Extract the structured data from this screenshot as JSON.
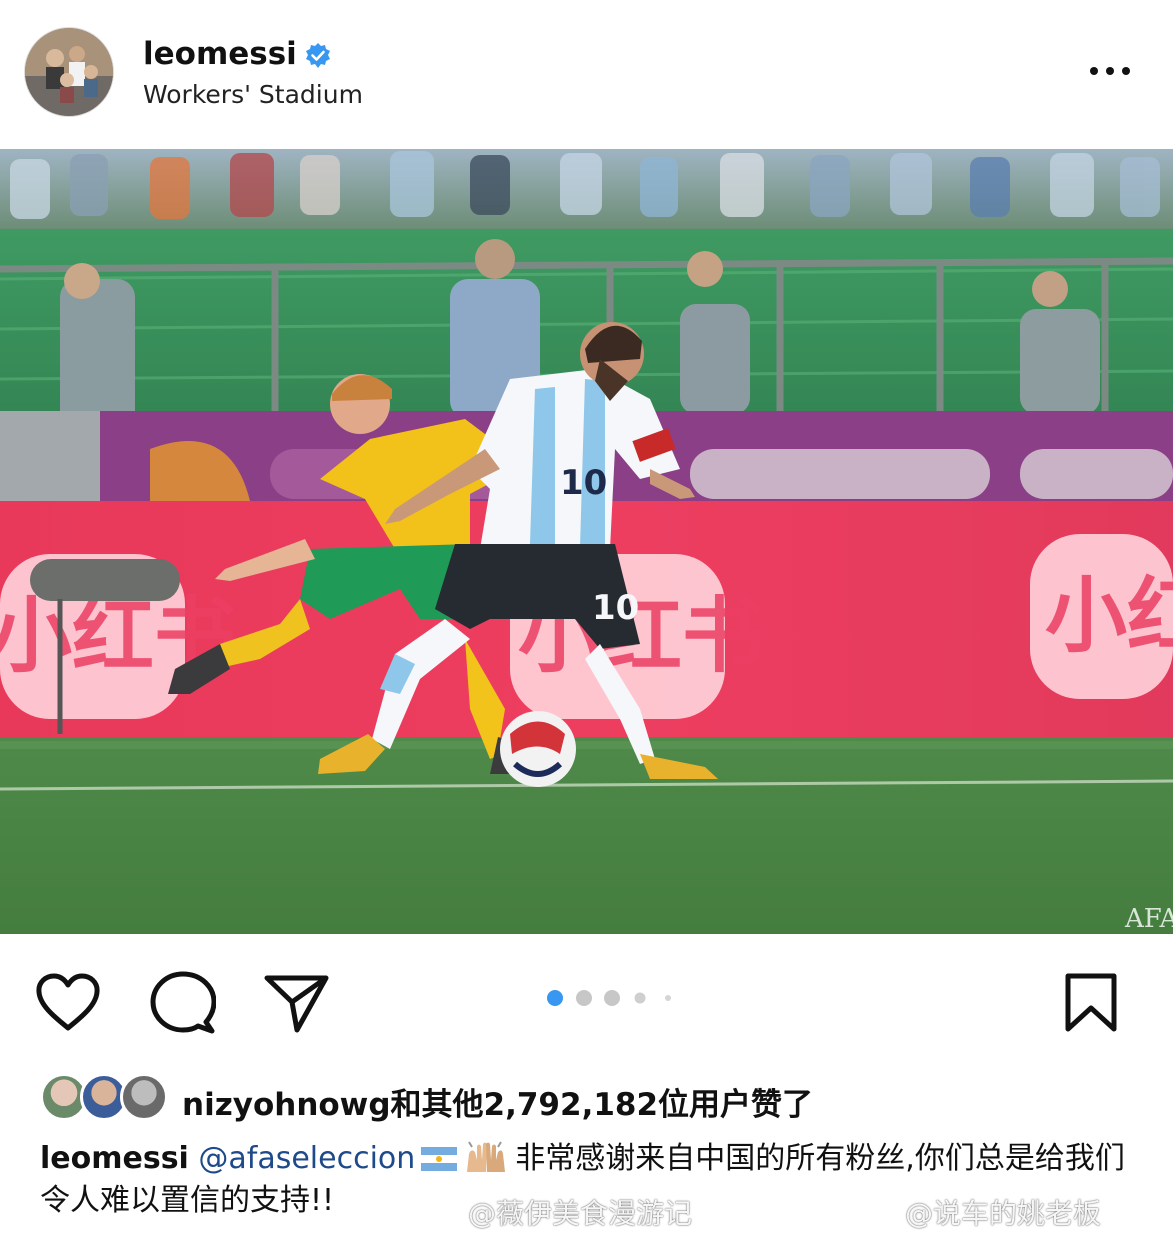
{
  "post": {
    "username": "leomessi",
    "location": "Workers' Stadium"
  },
  "carousel": {
    "total": 5,
    "active": 1
  },
  "photo": {
    "banner_text": "小红书",
    "jersey_number": "10",
    "watermark": "AFA"
  },
  "likes": {
    "first_liker": "nizyohnowg",
    "suffix": "和其他2,792,182位用户赞了"
  },
  "caption": {
    "user": "leomessi",
    "mention": "@afaseleccion",
    "text": "非常感谢来自中国的所有粉丝,你们总是给我们令人难以置信的支持!!"
  },
  "watermarks": {
    "left": "@薇伊美食漫游记",
    "right": "@说车的姚老板"
  },
  "colors": {
    "verified": "#3897f0",
    "dot_active": "#3897f0",
    "dot_inactive": "#c7c7c7",
    "mention": "#1f4a8a"
  }
}
